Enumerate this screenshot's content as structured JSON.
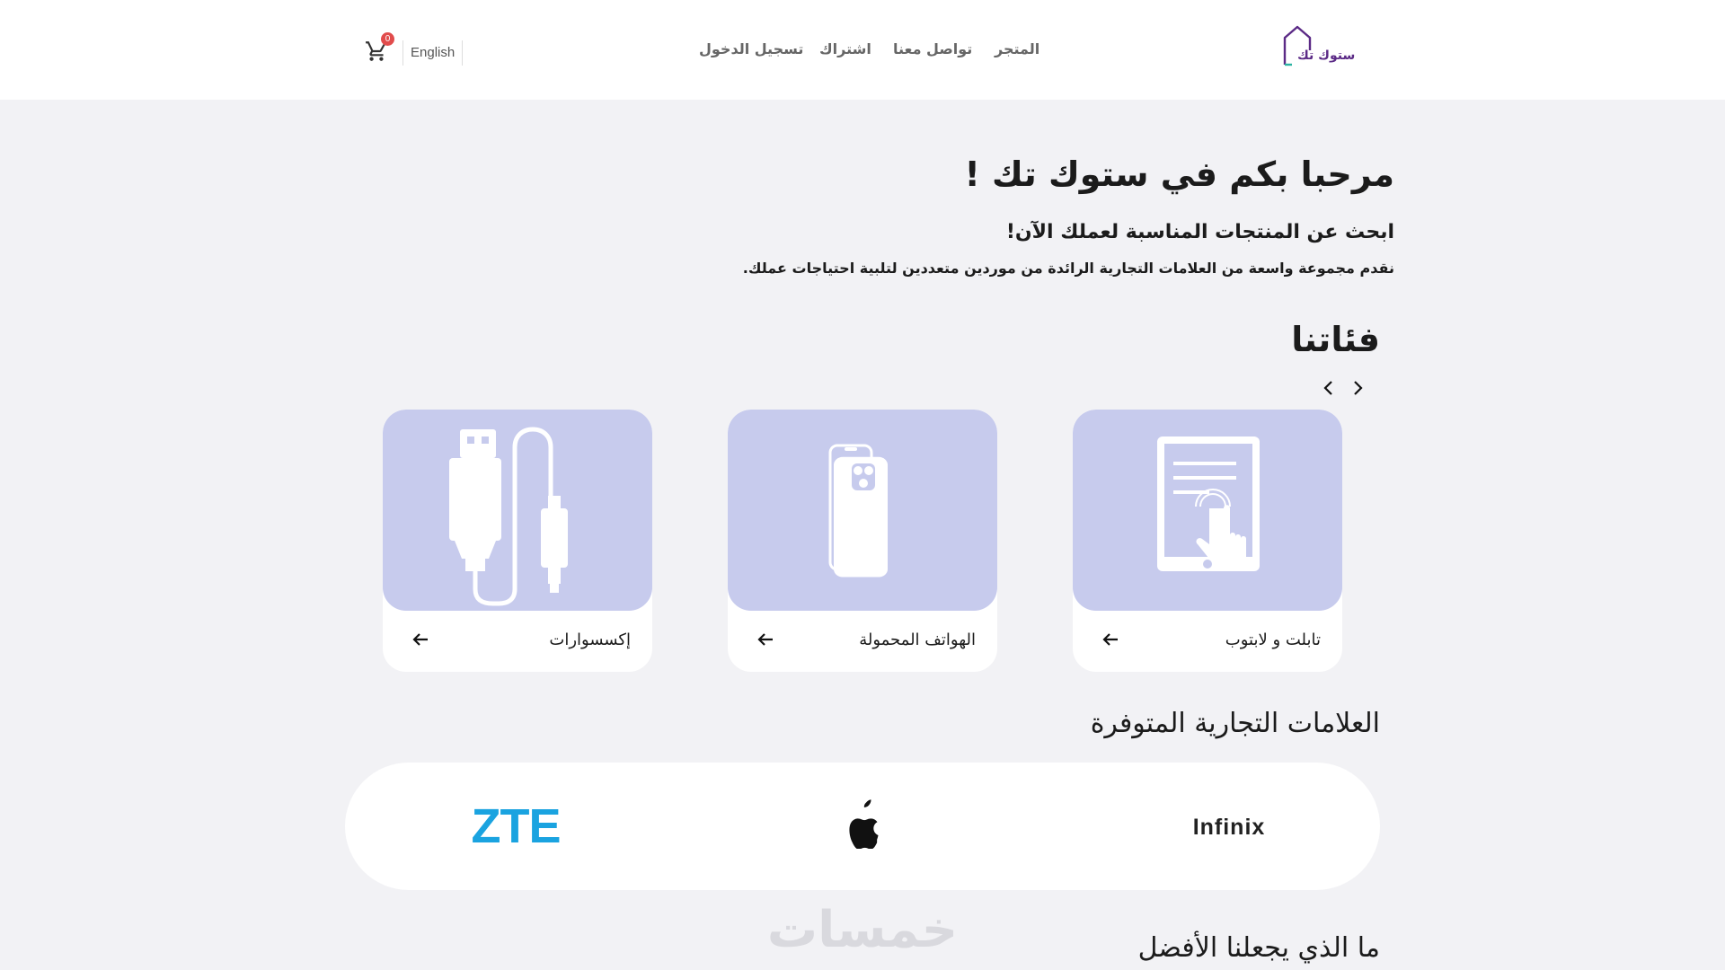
{
  "header": {
    "logo_text": "ستوك تك",
    "nav": {
      "store": "المتجر",
      "contact": "تواصل معنا",
      "subscribe": "اشتراك",
      "login": "تسجيل الدخول"
    },
    "language": "English",
    "cart_count": "0"
  },
  "hero": {
    "title": "مرحبا بكم في ستوك تك !",
    "subtitle": "ابحث عن المنتجات المناسبة لعملك الآن!",
    "description": "نقدم مجموعة واسعة من العلامات التجارية الرائدة من موردين متعددين لتلبية احتياجات عملك."
  },
  "categories": {
    "title": "فئاتنا",
    "items": [
      {
        "label": "تابلت و لابتوب",
        "icon": "tablet-touch-icon"
      },
      {
        "label": "الهواتف المحمولة",
        "icon": "smartphone-icon"
      },
      {
        "label": "إكسسوارات",
        "icon": "usb-cable-icon"
      }
    ]
  },
  "brands": {
    "title": "العلامات التجارية المتوفرة",
    "items": [
      {
        "name": "Infinix",
        "color": "#222222"
      },
      {
        "name": "Apple",
        "color": "#111111"
      },
      {
        "name": "ZTE",
        "color": "#1aa3e0"
      }
    ]
  },
  "why_us": {
    "title": "ما الذي يجعلنا الأفضل"
  },
  "watermark": "خمسات",
  "colors": {
    "accent_purple": "#5b2a86",
    "card_bg": "#c7cbed",
    "badge_red": "#e14c4c",
    "teal": "#2bb3a3"
  }
}
